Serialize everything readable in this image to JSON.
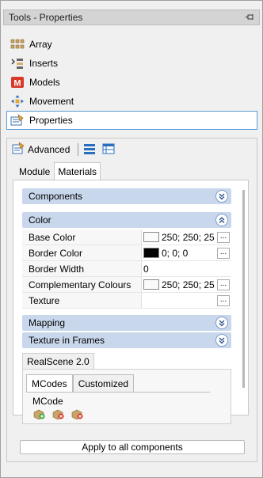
{
  "window": {
    "title": "Tools - Properties"
  },
  "nav": {
    "items": [
      {
        "label": "Array",
        "icon": "array-icon"
      },
      {
        "label": "Inserts",
        "icon": "inserts-icon"
      },
      {
        "label": "Models",
        "icon": "models-icon"
      },
      {
        "label": "Movement",
        "icon": "movement-icon"
      },
      {
        "label": "Properties",
        "icon": "properties-icon",
        "selected": true
      }
    ]
  },
  "panel": {
    "advanced_label": "Advanced",
    "tabs": [
      "Module",
      "Materials"
    ],
    "active_tab": "Materials",
    "sections": {
      "components": "Components",
      "color": "Color",
      "mapping": "Mapping",
      "texture_in_frames": "Texture in Frames"
    },
    "properties": [
      {
        "name": "Base Color",
        "value": "250; 250; 25",
        "swatch": "#fafafa"
      },
      {
        "name": "Border Color",
        "value": "0; 0; 0",
        "swatch": "#000000"
      },
      {
        "name": "Border Width",
        "value": "0"
      },
      {
        "name": "Complementary Colours",
        "value": "250; 250; 25",
        "swatch": "#fafafa"
      },
      {
        "name": "Texture",
        "value": ""
      }
    ],
    "realscene": {
      "tab_label": "RealScene 2.0",
      "subtabs": [
        "MCodes",
        "Customized"
      ],
      "mcode_label": "MCode"
    },
    "apply_button": "Apply to all components"
  }
}
